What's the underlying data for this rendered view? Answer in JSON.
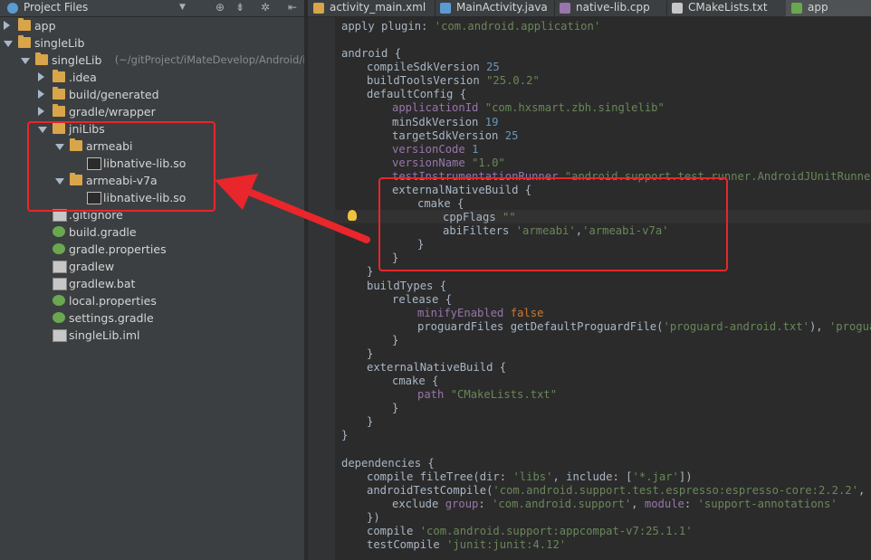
{
  "project_panel": {
    "title": "Project Files",
    "tree": [
      {
        "label": "app",
        "kind": "folder",
        "state": "collapsed",
        "depth": 0
      },
      {
        "label": "singleLib",
        "kind": "folder",
        "state": "expanded",
        "depth": 0
      },
      {
        "label": "singleLib",
        "suffix": "(~/gitProject/iMateDevelop/Android/iM",
        "kind": "folder",
        "state": "expanded",
        "depth": 1
      },
      {
        "label": ".idea",
        "kind": "folder",
        "state": "collapsed",
        "depth": 2
      },
      {
        "label": "build/generated",
        "kind": "folder",
        "state": "collapsed",
        "depth": 2
      },
      {
        "label": "gradle/wrapper",
        "kind": "folder",
        "state": "collapsed",
        "depth": 2
      },
      {
        "label": "jniLibs",
        "kind": "folder",
        "state": "expanded",
        "depth": 2
      },
      {
        "label": "armeabi",
        "kind": "folder",
        "state": "expanded",
        "depth": 3
      },
      {
        "label": "libnative-lib.so",
        "kind": "binfile",
        "depth": 4
      },
      {
        "label": "armeabi-v7a",
        "kind": "folder",
        "state": "expanded",
        "depth": 3
      },
      {
        "label": "libnative-lib.so",
        "kind": "binfile",
        "depth": 4
      },
      {
        "label": ".gitignore",
        "kind": "file",
        "depth": 2
      },
      {
        "label": "build.gradle",
        "kind": "gradle",
        "depth": 2
      },
      {
        "label": "gradle.properties",
        "kind": "gradle",
        "depth": 2
      },
      {
        "label": "gradlew",
        "kind": "file",
        "depth": 2
      },
      {
        "label": "gradlew.bat",
        "kind": "file",
        "depth": 2
      },
      {
        "label": "local.properties",
        "kind": "gradle",
        "depth": 2
      },
      {
        "label": "settings.gradle",
        "kind": "gradle",
        "depth": 2
      },
      {
        "label": "singleLib.iml",
        "kind": "file",
        "depth": 2
      }
    ]
  },
  "tabs": [
    {
      "label": "activity_main.xml",
      "icon": "xml-icon",
      "color": "#d9a54a"
    },
    {
      "label": "MainActivity.java",
      "icon": "class-icon",
      "color": "#5b9bd5"
    },
    {
      "label": "native-lib.cpp",
      "icon": "cpp-icon",
      "color": "#9876aa"
    },
    {
      "label": "CMakeLists.txt",
      "icon": "text-icon",
      "color": "#c7c7c7"
    },
    {
      "label": "app",
      "icon": "gradle-icon",
      "color": "#6aa84f",
      "active": true
    }
  ],
  "code": [
    {
      "indent": 0,
      "parts": [
        [
          "plain",
          "apply plugin: "
        ],
        [
          "str",
          "'com.android.application'"
        ]
      ]
    },
    {
      "indent": 0,
      "parts": []
    },
    {
      "indent": 0,
      "parts": [
        [
          "plain",
          "android {"
        ]
      ]
    },
    {
      "indent": 1,
      "parts": [
        [
          "plain",
          "compileSdkVersion "
        ],
        [
          "num",
          "25"
        ]
      ]
    },
    {
      "indent": 1,
      "parts": [
        [
          "plain",
          "buildToolsVersion "
        ],
        [
          "str",
          "\"25.0.2\""
        ]
      ]
    },
    {
      "indent": 1,
      "parts": [
        [
          "plain",
          "defaultConfig {"
        ]
      ]
    },
    {
      "indent": 2,
      "parts": [
        [
          "prop",
          "applicationId "
        ],
        [
          "str",
          "\"com.hxsmart.zbh.singlelib\""
        ]
      ]
    },
    {
      "indent": 2,
      "parts": [
        [
          "plain",
          "minSdkVersion "
        ],
        [
          "num",
          "19"
        ]
      ]
    },
    {
      "indent": 2,
      "parts": [
        [
          "plain",
          "targetSdkVersion "
        ],
        [
          "num",
          "25"
        ]
      ]
    },
    {
      "indent": 2,
      "parts": [
        [
          "prop",
          "versionCode "
        ],
        [
          "num",
          "1"
        ]
      ]
    },
    {
      "indent": 2,
      "parts": [
        [
          "prop",
          "versionName "
        ],
        [
          "str",
          "\"1.0\""
        ]
      ]
    },
    {
      "indent": 2,
      "parts": [
        [
          "prop",
          "testInstrumentationRunner "
        ],
        [
          "str",
          "\"android.support.test.runner.AndroidJUnitRunner\""
        ]
      ]
    },
    {
      "indent": 2,
      "parts": [
        [
          "plain",
          "externalNativeBuild {"
        ]
      ]
    },
    {
      "indent": 3,
      "parts": [
        [
          "plain",
          "cmake {"
        ]
      ]
    },
    {
      "indent": 4,
      "parts": [
        [
          "plain",
          "cppFlags "
        ],
        [
          "str",
          "\"\""
        ]
      ]
    },
    {
      "indent": 4,
      "parts": [
        [
          "plain",
          "abiFilters "
        ],
        [
          "str",
          "'armeabi'"
        ],
        [
          "plain",
          ","
        ],
        [
          "str",
          "'armeabi-v7a'"
        ]
      ]
    },
    {
      "indent": 3,
      "parts": [
        [
          "plain",
          "}"
        ]
      ]
    },
    {
      "indent": 2,
      "parts": [
        [
          "plain",
          "}"
        ]
      ]
    },
    {
      "indent": 1,
      "parts": [
        [
          "plain",
          "}"
        ]
      ]
    },
    {
      "indent": 1,
      "parts": [
        [
          "plain",
          "buildTypes {"
        ]
      ]
    },
    {
      "indent": 2,
      "parts": [
        [
          "plain",
          "release {"
        ]
      ]
    },
    {
      "indent": 3,
      "parts": [
        [
          "prop",
          "minifyEnabled "
        ],
        [
          "kw",
          "false"
        ]
      ]
    },
    {
      "indent": 3,
      "parts": [
        [
          "plain",
          "proguardFiles getDefaultProguardFile("
        ],
        [
          "str",
          "'proguard-android.txt'"
        ],
        [
          "plain",
          "), "
        ],
        [
          "str",
          "'proguard-"
        ]
      ]
    },
    {
      "indent": 2,
      "parts": [
        [
          "plain",
          "}"
        ]
      ]
    },
    {
      "indent": 1,
      "parts": [
        [
          "plain",
          "}"
        ]
      ]
    },
    {
      "indent": 1,
      "parts": [
        [
          "plain",
          "externalNativeBuild {"
        ]
      ]
    },
    {
      "indent": 2,
      "parts": [
        [
          "plain",
          "cmake {"
        ]
      ]
    },
    {
      "indent": 3,
      "parts": [
        [
          "prop",
          "path "
        ],
        [
          "str",
          "\"CMakeLists.txt\""
        ]
      ]
    },
    {
      "indent": 2,
      "parts": [
        [
          "plain",
          "}"
        ]
      ]
    },
    {
      "indent": 1,
      "parts": [
        [
          "plain",
          "}"
        ]
      ]
    },
    {
      "indent": 0,
      "parts": [
        [
          "plain",
          "}"
        ]
      ]
    },
    {
      "indent": 0,
      "parts": []
    },
    {
      "indent": 0,
      "parts": [
        [
          "plain",
          "dependencies {"
        ]
      ]
    },
    {
      "indent": 1,
      "parts": [
        [
          "plain",
          "compile fileTree(dir: "
        ],
        [
          "str",
          "'libs'"
        ],
        [
          "plain",
          ", include: ["
        ],
        [
          "str",
          "'*.jar'"
        ],
        [
          "plain",
          "])"
        ]
      ]
    },
    {
      "indent": 1,
      "parts": [
        [
          "plain",
          "androidTestCompile("
        ],
        [
          "str",
          "'com.android.support.test.espresso:espresso-core:2.2.2'"
        ],
        [
          "plain",
          ", {"
        ]
      ]
    },
    {
      "indent": 2,
      "parts": [
        [
          "plain",
          "exclude "
        ],
        [
          "prop",
          "group"
        ],
        [
          "plain",
          ": "
        ],
        [
          "str",
          "'com.android.support'"
        ],
        [
          "plain",
          ", "
        ],
        [
          "prop",
          "module"
        ],
        [
          "plain",
          ": "
        ],
        [
          "str",
          "'support-annotations'"
        ]
      ]
    },
    {
      "indent": 1,
      "parts": [
        [
          "plain",
          "})"
        ]
      ]
    },
    {
      "indent": 1,
      "parts": [
        [
          "plain",
          "compile "
        ],
        [
          "str",
          "'com.android.support:appcompat-v7:25.1.1'"
        ]
      ]
    },
    {
      "indent": 1,
      "parts": [
        [
          "plain",
          "testCompile "
        ],
        [
          "str",
          "'junit:junit:4.12'"
        ]
      ]
    }
  ],
  "colors": {
    "highlight_box": "#e8262b",
    "background": "#2b2b2b",
    "panel": "#3c3f41"
  }
}
